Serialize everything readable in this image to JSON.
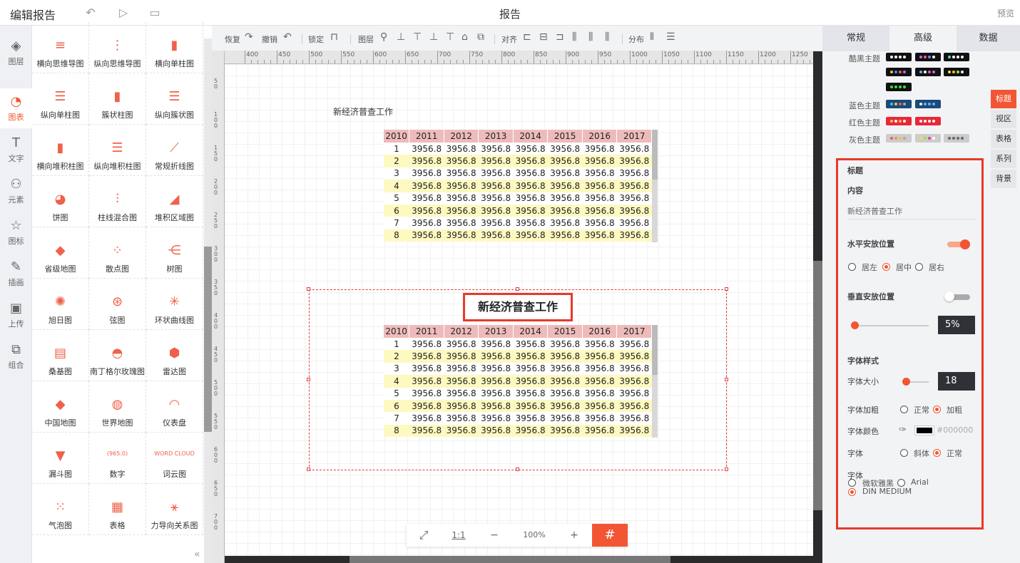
{
  "app": {
    "title": "编辑报告",
    "doc_title": "报告",
    "preview": "预览"
  },
  "rail": [
    {
      "label": "图层",
      "icon": "layers-icon",
      "glyph": "◈"
    },
    {
      "label": "图表",
      "icon": "chart-icon",
      "glyph": "◔"
    },
    {
      "label": "文字",
      "icon": "text-icon",
      "glyph": "T"
    },
    {
      "label": "元素",
      "icon": "shapes-icon",
      "glyph": "⚇"
    },
    {
      "label": "图标",
      "icon": "star-icon",
      "glyph": "☆"
    },
    {
      "label": "插画",
      "icon": "palette-icon",
      "glyph": "✎"
    },
    {
      "label": "上传",
      "icon": "upload-image-icon",
      "glyph": "▣"
    },
    {
      "label": "组合",
      "icon": "group-icon",
      "glyph": "⧉"
    }
  ],
  "library": [
    {
      "label": "横向思维导图",
      "glyph": "≡"
    },
    {
      "label": "纵向思维导图",
      "glyph": "⋮"
    },
    {
      "label": "横向单柱图",
      "glyph": "▮"
    },
    {
      "label": "纵向单柱图",
      "glyph": "☰"
    },
    {
      "label": "簇状柱图",
      "glyph": "▮"
    },
    {
      "label": "纵向簇状图",
      "glyph": "☰"
    },
    {
      "label": "横向堆积柱图",
      "glyph": "▮"
    },
    {
      "label": "纵向堆积柱图",
      "glyph": "☰"
    },
    {
      "label": "常规折线图",
      "glyph": "⟋"
    },
    {
      "label": "饼图",
      "glyph": "◕"
    },
    {
      "label": "柱线混合图",
      "glyph": "⫶"
    },
    {
      "label": "堆积区域图",
      "glyph": "◢"
    },
    {
      "label": "省级地图",
      "glyph": "◆"
    },
    {
      "label": "散点图",
      "glyph": "⁘"
    },
    {
      "label": "树图",
      "glyph": "⋲"
    },
    {
      "label": "旭日图",
      "glyph": "✺"
    },
    {
      "label": "弦图",
      "glyph": "⊛"
    },
    {
      "label": "环状曲线图",
      "glyph": "✳"
    },
    {
      "label": "桑基图",
      "glyph": "▤"
    },
    {
      "label": "南丁格尔玫瑰图",
      "glyph": "◓"
    },
    {
      "label": "雷达图",
      "glyph": "⬢"
    },
    {
      "label": "中国地图",
      "glyph": "◆"
    },
    {
      "label": "世界地图",
      "glyph": "◍"
    },
    {
      "label": "仪表盘",
      "glyph": "◠"
    },
    {
      "label": "漏斗图",
      "glyph": "▼"
    },
    {
      "label": "数字",
      "glyph": "(965.0)"
    },
    {
      "label": "词云图",
      "glyph": "WORD CLOUD"
    },
    {
      "label": "气泡图",
      "glyph": "⁙"
    },
    {
      "label": "表格",
      "glyph": "▦"
    },
    {
      "label": "力导向关系图",
      "glyph": "⚹"
    }
  ],
  "toolbar": {
    "redo": "恢复",
    "undo": "撤销",
    "lock": "锁定",
    "layer": "图层",
    "align": "对齐",
    "distribute": "分布"
  },
  "ruler": {
    "top": [
      "400",
      "450",
      "500",
      "550",
      "600",
      "650",
      "700",
      "750",
      "800",
      "850",
      "900",
      "950",
      "1000",
      "1050",
      "1100",
      "1150",
      "1200",
      "1250"
    ],
    "left": [
      "50",
      "100",
      "150",
      "200",
      "250",
      "300",
      "350",
      "400",
      "450",
      "500",
      "550",
      "600",
      "650",
      "700"
    ]
  },
  "widget1": {
    "title": "新经济普查工作"
  },
  "widget2": {
    "title": "新经济普查工作"
  },
  "table": {
    "headers": [
      "2010",
      "2011",
      "2012",
      "2013",
      "2014",
      "2015",
      "2016",
      "2017"
    ],
    "rows": [
      [
        "1",
        "3956.8",
        "3956.8",
        "3956.8",
        "3956.8",
        "3956.8",
        "3956.8",
        "3956.8"
      ],
      [
        "2",
        "3956.8",
        "3956.8",
        "3956.8",
        "3956.8",
        "3956.8",
        "3956.8",
        "3956.8"
      ],
      [
        "3",
        "3956.8",
        "3956.8",
        "3956.8",
        "3956.8",
        "3956.8",
        "3956.8",
        "3956.8"
      ],
      [
        "4",
        "3956.8",
        "3956.8",
        "3956.8",
        "3956.8",
        "3956.8",
        "3956.8",
        "3956.8"
      ],
      [
        "5",
        "3956.8",
        "3956.8",
        "3956.8",
        "3956.8",
        "3956.8",
        "3956.8",
        "3956.8"
      ],
      [
        "6",
        "3956.8",
        "3956.8",
        "3956.8",
        "3956.8",
        "3956.8",
        "3956.8",
        "3956.8"
      ],
      [
        "7",
        "3956.8",
        "3956.8",
        "3956.8",
        "3956.8",
        "3956.8",
        "3956.8",
        "3956.8"
      ],
      [
        "8",
        "3956.8",
        "3956.8",
        "3956.8",
        "3956.8",
        "3956.8",
        "3956.8",
        "3956.8"
      ]
    ]
  },
  "zoom": {
    "fit": "⤢",
    "one_to_one": "1:1",
    "minus": "−",
    "level": "100%",
    "plus": "+",
    "grid": "#"
  },
  "right": {
    "tabs": [
      "常规",
      "高级",
      "数据"
    ],
    "themes": [
      {
        "label": "酷黑主题"
      },
      {
        "label": "蓝色主题"
      },
      {
        "label": "红色主题"
      },
      {
        "label": "灰色主题"
      }
    ],
    "sidenav": [
      "标题",
      "视区",
      "表格",
      "系列",
      "背景"
    ],
    "panel": {
      "section": "标题",
      "content_label": "内容",
      "content_value": "新经济普查工作",
      "h_pos_label": "水平安放位置",
      "h_left": "居左",
      "h_center": "居中",
      "h_right": "居右",
      "v_pos_label": "垂直安放位置",
      "v_value": "5%",
      "font_style_label": "字体样式",
      "font_size_label": "字体大小",
      "font_size_value": "18",
      "bold_label": "字体加粗",
      "bold_normal": "正常",
      "bold_bold": "加粗",
      "color_label": "字体颜色",
      "color_value": "#000000",
      "italic_label": "字体",
      "italic_italic": "斜体",
      "italic_normal": "正常",
      "family_label": "字体",
      "family_yahei": "微软雅黑",
      "family_arial": "Arial",
      "family_din": "DIN MEDIUM"
    }
  },
  "colors": {
    "accent": "#f25533",
    "header_row": "#eebbbb",
    "stripe": "#fdf9c0"
  }
}
